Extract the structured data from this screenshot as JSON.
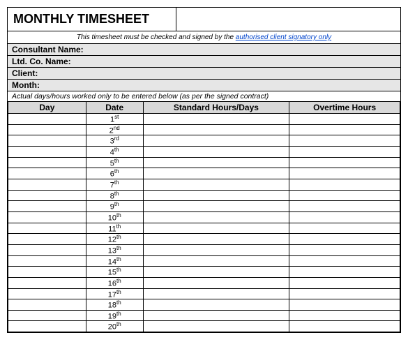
{
  "title": "MONTHLY TIMESHEET",
  "notice_prefix": "This timesheet must be checked and signed by the ",
  "notice_link": "authorised client signatory only",
  "info": {
    "consultant_label": "Consultant Name:",
    "consultant_value": "",
    "company_label": "Ltd. Co. Name:",
    "company_value": "",
    "client_label": "Client:",
    "client_value": "",
    "month_label": "Month:",
    "month_value": ""
  },
  "subnote": "Actual days/hours worked only to be entered below (as per the signed contract)",
  "headers": {
    "day": "Day",
    "date": "Date",
    "std": "Standard Hours/Days",
    "ot": "Overtime Hours"
  },
  "rows": [
    {
      "day": "",
      "date_num": "1",
      "date_ord": "st",
      "std": "",
      "ot": ""
    },
    {
      "day": "",
      "date_num": "2",
      "date_ord": "nd",
      "std": "",
      "ot": ""
    },
    {
      "day": "",
      "date_num": "3",
      "date_ord": "rd",
      "std": "",
      "ot": ""
    },
    {
      "day": "",
      "date_num": "4",
      "date_ord": "th",
      "std": "",
      "ot": ""
    },
    {
      "day": "",
      "date_num": "5",
      "date_ord": "th",
      "std": "",
      "ot": ""
    },
    {
      "day": "",
      "date_num": "6",
      "date_ord": "th",
      "std": "",
      "ot": ""
    },
    {
      "day": "",
      "date_num": "7",
      "date_ord": "th",
      "std": "",
      "ot": ""
    },
    {
      "day": "",
      "date_num": "8",
      "date_ord": "th",
      "std": "",
      "ot": ""
    },
    {
      "day": "",
      "date_num": "9",
      "date_ord": "th",
      "std": "",
      "ot": ""
    },
    {
      "day": "",
      "date_num": "10",
      "date_ord": "th",
      "std": "",
      "ot": ""
    },
    {
      "day": "",
      "date_num": "11",
      "date_ord": "th",
      "std": "",
      "ot": ""
    },
    {
      "day": "",
      "date_num": "12",
      "date_ord": "th",
      "std": "",
      "ot": ""
    },
    {
      "day": "",
      "date_num": "13",
      "date_ord": "th",
      "std": "",
      "ot": ""
    },
    {
      "day": "",
      "date_num": "14",
      "date_ord": "th",
      "std": "",
      "ot": ""
    },
    {
      "day": "",
      "date_num": "15",
      "date_ord": "th",
      "std": "",
      "ot": ""
    },
    {
      "day": "",
      "date_num": "16",
      "date_ord": "th",
      "std": "",
      "ot": ""
    },
    {
      "day": "",
      "date_num": "17",
      "date_ord": "th",
      "std": "",
      "ot": ""
    },
    {
      "day": "",
      "date_num": "18",
      "date_ord": "th",
      "std": "",
      "ot": ""
    },
    {
      "day": "",
      "date_num": "19",
      "date_ord": "th",
      "std": "",
      "ot": ""
    },
    {
      "day": "",
      "date_num": "20",
      "date_ord": "th",
      "std": "",
      "ot": ""
    }
  ]
}
